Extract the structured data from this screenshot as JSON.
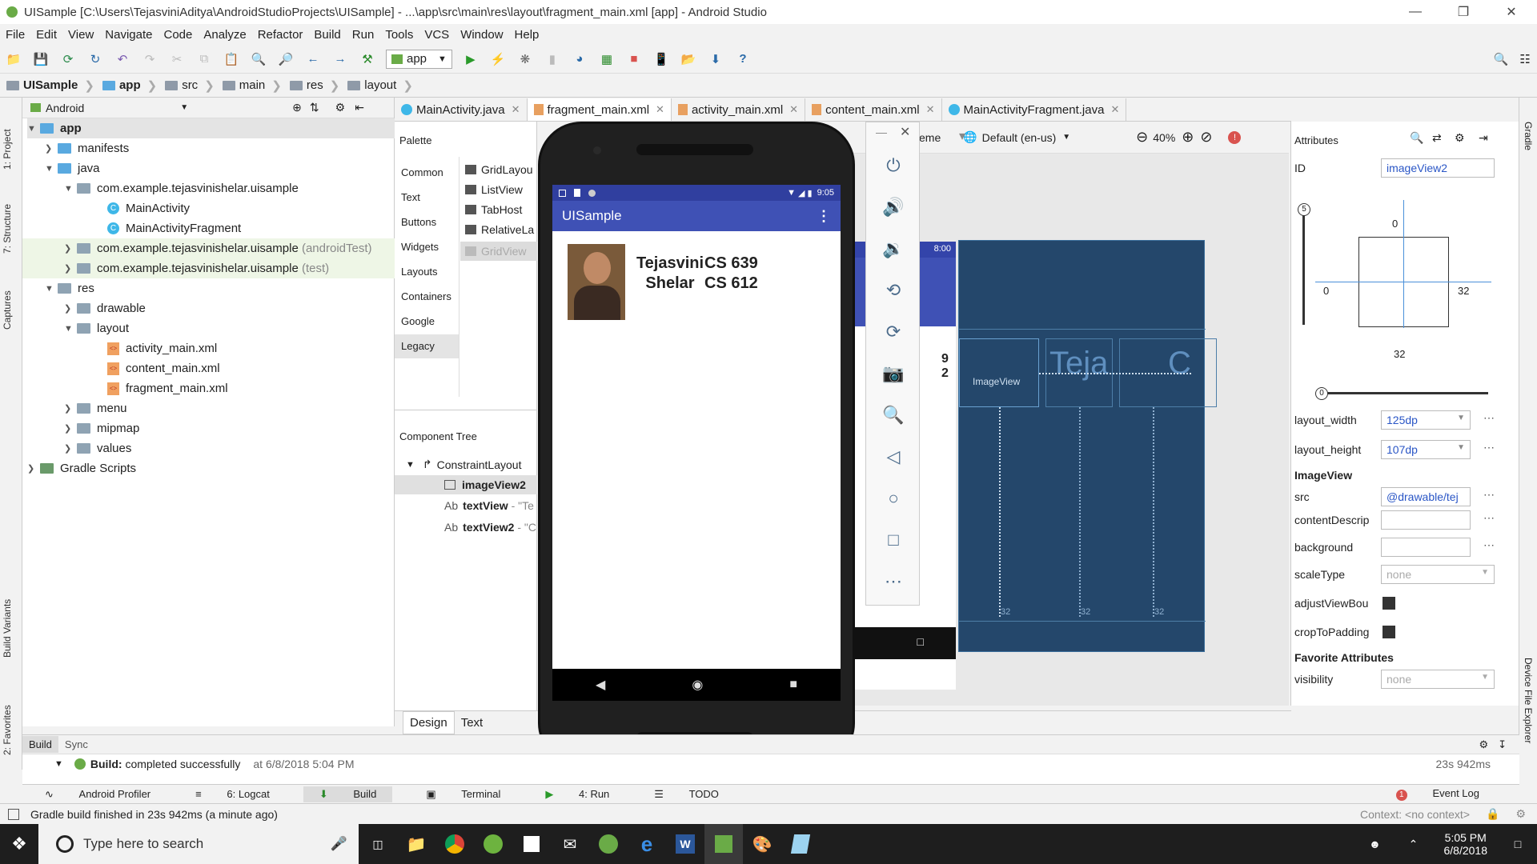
{
  "window": {
    "title": "UISample [C:\\Users\\TejasviniAditya\\AndroidStudioProjects\\UISample] - ...\\app\\src\\main\\res\\layout\\fragment_main.xml [app] - Android Studio"
  },
  "menu": [
    "File",
    "Edit",
    "View",
    "Navigate",
    "Code",
    "Analyze",
    "Refactor",
    "Build",
    "Run",
    "Tools",
    "VCS",
    "Window",
    "Help"
  ],
  "toolbar": {
    "run_config": "app"
  },
  "breadcrumbs": [
    "UISample",
    "app",
    "src",
    "main",
    "res",
    "layout"
  ],
  "project_panel": {
    "view_mode": "Android",
    "tree": [
      {
        "label": "app",
        "bold": true
      },
      {
        "label": "manifests"
      },
      {
        "label": "java"
      },
      {
        "label": "com.example.tejasvinishelar.uisample"
      },
      {
        "label": "MainActivity"
      },
      {
        "label": "MainActivityFragment"
      },
      {
        "label": "com.example.tejasvinishelar.uisample",
        "suffix": "(androidTest)"
      },
      {
        "label": "com.example.tejasvinishelar.uisample",
        "suffix": "(test)"
      },
      {
        "label": "res"
      },
      {
        "label": "drawable"
      },
      {
        "label": "layout"
      },
      {
        "label": "activity_main.xml"
      },
      {
        "label": "content_main.xml"
      },
      {
        "label": "fragment_main.xml"
      },
      {
        "label": "menu"
      },
      {
        "label": "mipmap"
      },
      {
        "label": "values"
      },
      {
        "label": "Gradle Scripts"
      }
    ]
  },
  "left_strip": [
    "1: Project",
    "7: Structure",
    "Captures",
    "Build Variants",
    "2: Favorites"
  ],
  "right_strip": [
    "Gradle",
    "Device File Explorer"
  ],
  "editor_tabs": [
    {
      "label": "MainActivity.java"
    },
    {
      "label": "fragment_main.xml",
      "active": true
    },
    {
      "label": "activity_main.xml"
    },
    {
      "label": "content_main.xml"
    },
    {
      "label": "MainActivityFragment.java"
    }
  ],
  "palette": {
    "title": "Palette",
    "categories": [
      "Common",
      "Text",
      "Buttons",
      "Widgets",
      "Layouts",
      "Containers",
      "Google",
      "Legacy"
    ],
    "items": [
      "GridLayou",
      "ListView",
      "TabHost",
      "RelativeLa",
      "GridView"
    ]
  },
  "component_tree": {
    "title": "Component Tree",
    "root": "ConstraintLayout",
    "children": [
      {
        "label": "imageView2",
        "prefix": ""
      },
      {
        "label": "textView",
        "prefix": "Ab",
        "hint": "- \"Te"
      },
      {
        "label": "textView2",
        "prefix": "Ab",
        "hint": "- \"C"
      }
    ]
  },
  "design_toolbar": {
    "theme_label": "eme",
    "locale": "Default (en-us)",
    "zoom": "40%"
  },
  "design_tabs": [
    "Design",
    "Text"
  ],
  "emulator": {
    "status_time": "9:05",
    "app_title": "UISample",
    "name_line1": "Tejasvini",
    "name_line2": "Shelar",
    "course1": "CS 639",
    "course2": "CS 612"
  },
  "preview": {
    "time": "8:00",
    "num1": "9",
    "num2": "2"
  },
  "blueprint": {
    "image_label": "ImageView",
    "text1": "Teja",
    "text2": "C",
    "margin": "32"
  },
  "attributes": {
    "title": "Attributes",
    "id_label": "ID",
    "id_value": "imageView2",
    "constraint_top": "0",
    "constraint_left": "0",
    "constraint_right": "32",
    "constraint_bottom": "32",
    "bias": "0",
    "bias_top": "5",
    "layout_width_label": "layout_width",
    "layout_width": "125dp",
    "layout_height_label": "layout_height",
    "layout_height": "107dp",
    "section": "ImageView",
    "src_label": "src",
    "src": "@drawable/tej",
    "content_label": "contentDescrip",
    "background_label": "background",
    "scale_label": "scaleType",
    "scale": "none",
    "adjust_label": "adjustViewBou",
    "crop_label": "cropToPadding",
    "fav_section": "Favorite Attributes",
    "visibility_label": "visibility",
    "visibility": "none"
  },
  "build_panel": {
    "tabs": [
      "Build",
      "Sync"
    ],
    "message_bold": "Build:",
    "message": "completed successfully",
    "time": "at 6/8/2018 5:04 PM",
    "duration": "23s 942ms"
  },
  "bottom_tools": [
    "Android Profiler",
    "6: Logcat",
    "Build",
    "Terminal",
    "4: Run",
    "TODO"
  ],
  "event_log": "Event Log",
  "event_count": "1",
  "status": {
    "message": "Gradle build finished in 23s 942ms (a minute ago)",
    "context": "Context: <no context>"
  },
  "taskbar": {
    "search_placeholder": "Type here to search",
    "time": "5:05 PM",
    "date": "6/8/2018"
  },
  "colors": {
    "accent": "#3f51b5",
    "blueprint": "#24476b",
    "android_green": "#6aab47"
  }
}
